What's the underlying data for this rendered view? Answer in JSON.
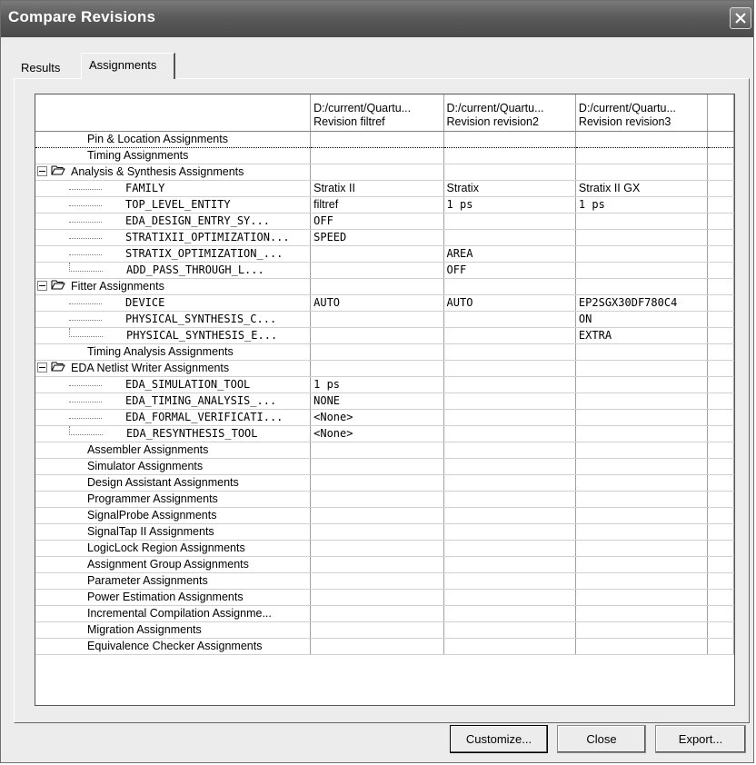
{
  "window": {
    "title": "Compare Revisions"
  },
  "tabs": [
    {
      "label": "Results"
    },
    {
      "label": "Assignments"
    }
  ],
  "table": {
    "headers": [
      "",
      "D:/current/Quartu...\nRevision filtref",
      "D:/current/Quartu...\nRevision revision2",
      "D:/current/Quartu...\nRevision revision3",
      ""
    ],
    "rows": [
      {
        "name": "Pin & Location Assignments",
        "v": [
          "",
          "",
          ""
        ]
      },
      {
        "name": "Timing Assignments",
        "v": [
          "",
          "",
          ""
        ]
      },
      {
        "name": "Analysis & Synthesis Assignments",
        "v": [
          "",
          "",
          ""
        ]
      },
      {
        "name": "FAMILY",
        "v": [
          "Stratix II",
          "Stratix",
          "Stratix II GX"
        ]
      },
      {
        "name": "TOP_LEVEL_ENTITY",
        "v": [
          "filtref",
          "1 ps",
          "1 ps"
        ]
      },
      {
        "name": "EDA_DESIGN_ENTRY_SY...",
        "v": [
          "OFF",
          "",
          ""
        ]
      },
      {
        "name": "STRATIXII_OPTIMIZATION...",
        "v": [
          "SPEED",
          "",
          ""
        ]
      },
      {
        "name": "STRATIX_OPTIMIZATION_...",
        "v": [
          "",
          "AREA",
          ""
        ]
      },
      {
        "name": "ADD_PASS_THROUGH_L...",
        "v": [
          "",
          "OFF",
          ""
        ]
      },
      {
        "name": "Fitter Assignments",
        "v": [
          "",
          "",
          ""
        ]
      },
      {
        "name": "DEVICE",
        "v": [
          "AUTO",
          "AUTO",
          "EP2SGX30DF780C4"
        ]
      },
      {
        "name": "PHYSICAL_SYNTHESIS_C...",
        "v": [
          "",
          "",
          "ON"
        ]
      },
      {
        "name": "PHYSICAL_SYNTHESIS_E...",
        "v": [
          "",
          "",
          "EXTRA"
        ]
      },
      {
        "name": "Timing Analysis Assignments",
        "v": [
          "",
          "",
          ""
        ]
      },
      {
        "name": "EDA Netlist Writer Assignments",
        "v": [
          "",
          "",
          ""
        ]
      },
      {
        "name": "EDA_SIMULATION_TOOL",
        "v": [
          "1 ps",
          "",
          ""
        ]
      },
      {
        "name": "EDA_TIMING_ANALYSIS_...",
        "v": [
          "NONE",
          "",
          ""
        ]
      },
      {
        "name": "EDA_FORMAL_VERIFICATI...",
        "v": [
          "<None>",
          "",
          ""
        ]
      },
      {
        "name": "EDA_RESYNTHESIS_TOOL",
        "v": [
          "<None>",
          "",
          ""
        ]
      },
      {
        "name": "Assembler Assignments",
        "v": [
          "",
          "",
          ""
        ]
      },
      {
        "name": "Simulator Assignments",
        "v": [
          "",
          "",
          ""
        ]
      },
      {
        "name": "Design Assistant Assignments",
        "v": [
          "",
          "",
          ""
        ]
      },
      {
        "name": "Programmer Assignments",
        "v": [
          "",
          "",
          ""
        ]
      },
      {
        "name": "SignalProbe Assignments",
        "v": [
          "",
          "",
          ""
        ]
      },
      {
        "name": "SignalTap II Assignments",
        "v": [
          "",
          "",
          ""
        ]
      },
      {
        "name": "LogicLock Region Assignments",
        "v": [
          "",
          "",
          ""
        ]
      },
      {
        "name": "Assignment Group Assignments",
        "v": [
          "",
          "",
          ""
        ]
      },
      {
        "name": "Parameter Assignments",
        "v": [
          "",
          "",
          ""
        ]
      },
      {
        "name": "Power Estimation Assignments",
        "v": [
          "",
          "",
          ""
        ]
      },
      {
        "name": "Incremental Compilation Assignme...",
        "v": [
          "",
          "",
          ""
        ]
      },
      {
        "name": "Migration Assignments",
        "v": [
          "",
          "",
          ""
        ]
      },
      {
        "name": "Equivalence Checker Assignments",
        "v": [
          "",
          "",
          ""
        ]
      }
    ]
  },
  "buttons": {
    "customize": "Customize...",
    "close": "Close",
    "export": "Export..."
  }
}
